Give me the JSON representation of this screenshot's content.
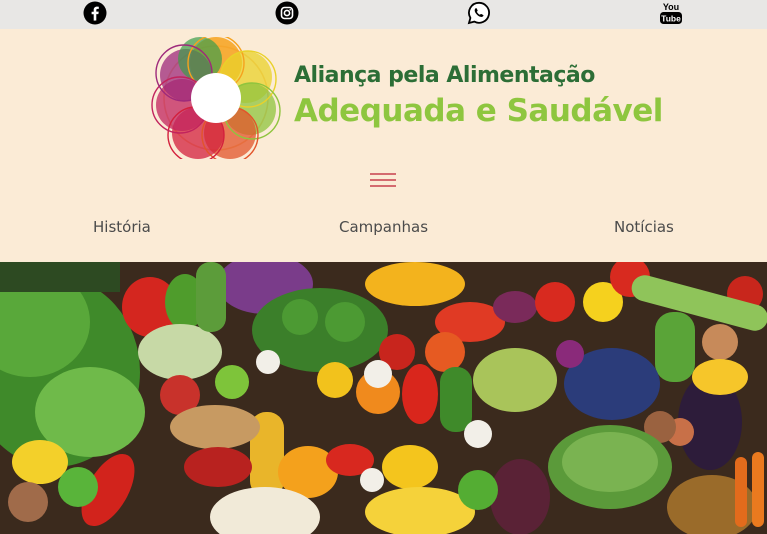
{
  "social": {
    "facebook": {
      "icon": "facebook-icon"
    },
    "instagram": {
      "icon": "instagram-icon"
    },
    "whatsapp": {
      "icon": "whatsapp-icon"
    },
    "youtube": {
      "icon": "youtube-icon",
      "text_top": "You",
      "text_bottom": "Tube"
    }
  },
  "brand": {
    "line1": "Aliança pela Alimentação",
    "line2": "Adequada e Saudável"
  },
  "nav": {
    "items": [
      {
        "label": "História"
      },
      {
        "label": "Campanhas"
      },
      {
        "label": "Notícias"
      }
    ]
  },
  "colors": {
    "header_bg": "#fbebd6",
    "social_bar_bg": "#e8e7e5",
    "brand_dark_green": "#2c6e36",
    "brand_light_green": "#8ec63f",
    "menu_icon": "#d46a6f",
    "nav_text": "#4b4b4b"
  },
  "hero": {
    "icon": "vegetables-banner-image"
  }
}
